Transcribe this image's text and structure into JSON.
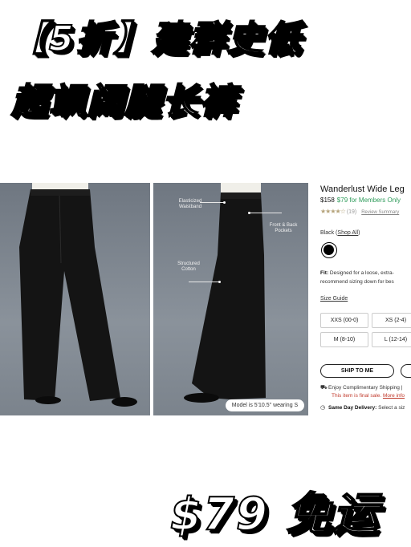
{
  "overlay": {
    "headline_line1": "【5折】建群史低",
    "headline_line2": "超飒阔腿长裤",
    "price_text": "$79 免运"
  },
  "callouts": {
    "waistband": "Elasticized Waistband",
    "pockets": "Front & Back Pockets",
    "cotton": "Structured Cotton"
  },
  "model_info": "Model is 5'10.5\" wearing S",
  "product": {
    "name": "Wanderlust Wide Leg",
    "price_regular": "$158",
    "price_member": "$79 for Members Only",
    "rating_stars": "★★★★☆",
    "review_count": "(19)",
    "review_link": "Review Summary",
    "color_prefix": "Black (",
    "color_link": "Shop All",
    "color_suffix": ")",
    "swatch_color": "#000000",
    "fit_label": "Fit:",
    "fit_text_line1": "Designed for a loose, extra-",
    "fit_text_line2": "recommend sizing down for bes",
    "size_guide": "Size Guide",
    "sizes": [
      "XXS (00-0)",
      "XS (2-4)",
      "M (8-10)",
      "L (12-14)"
    ],
    "ship_button": "SHIP TO ME",
    "shipping_text": "Enjoy Complimentary Shipping |",
    "final_sale_text": "This item is final sale.",
    "final_sale_link": "More info",
    "same_day_label": "Same Day Delivery:",
    "same_day_text": "Select a siz"
  },
  "icons": [
    "truck-icon",
    "clock-icon"
  ],
  "colors": {
    "member_price": "#2e9b5a",
    "final_sale": "#c0392b",
    "star": "#b5a37a",
    "photo_bg": "#7b838c"
  }
}
